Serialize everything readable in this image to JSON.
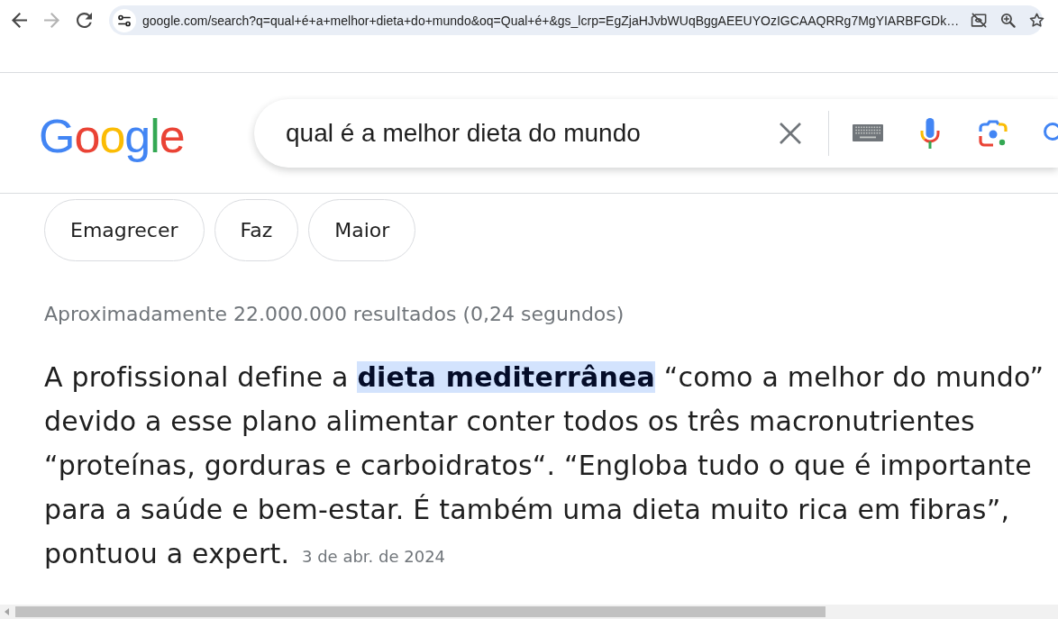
{
  "browser": {
    "nav_buttons": [
      {
        "disabled": false
      },
      {
        "disabled": true
      },
      {
        "disabled": false
      }
    ],
    "address": "google.com/search?q=qual+é+a+melhor+dieta+do+mundo&oq=Qual+é+&gs_lcrp=EgZjaHJvbWUqBggAEEUYOzIGCAAQRRg7MgYIARBFGDk…"
  },
  "logo": "Google",
  "search": {
    "query": "qual é a melhor dieta do mundo"
  },
  "chips": [
    "Emagrecer",
    "Faz",
    "Maior"
  ],
  "result_stats": "Aproximadamente 22.000.000 resultados (0,24 segundos)",
  "featured_snippet": {
    "text": "A profissional define a **dieta mediterrânea** “como a melhor do mundo” devido a esse plano alimentar conter todos os três macronutrientes “proteínas, gorduras e carboidratos“. “Engloba tudo o que é importante para a saúde e bem-estar. É também uma dieta muito rica em fibras”, pontuou a expert.",
    "date": "3 de abr. de 2024"
  }
}
